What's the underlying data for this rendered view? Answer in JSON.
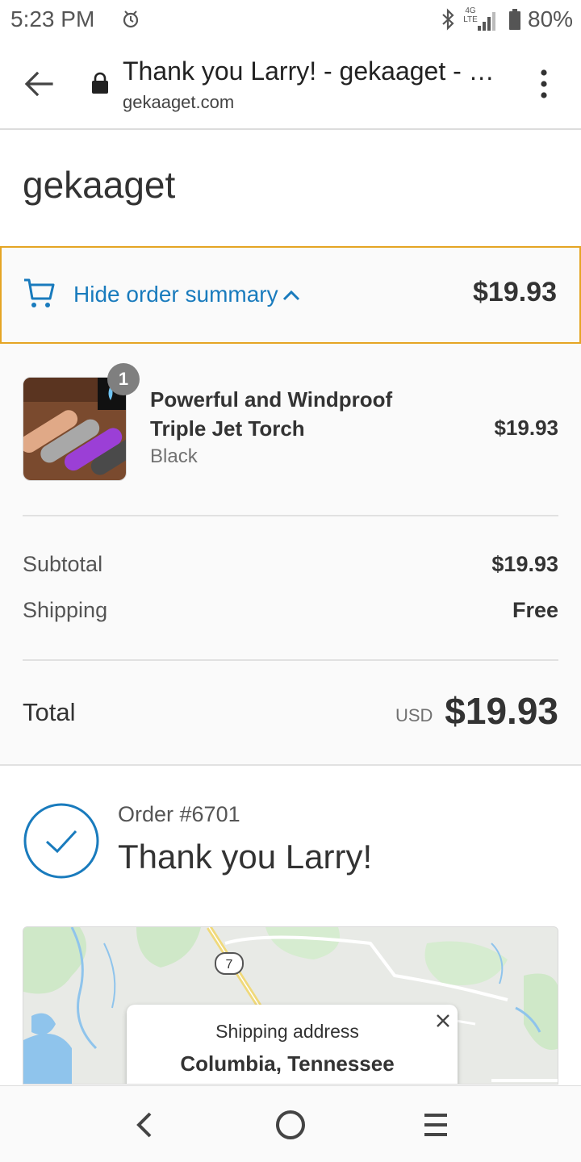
{
  "status_bar": {
    "time": "5:23 PM",
    "network_line1": "4G",
    "network_line2": "LTE",
    "battery": "80%"
  },
  "browser": {
    "title": "Thank you Larry! - gekaaget - C...",
    "url": "gekaaget.com"
  },
  "store": {
    "name": "gekaaget"
  },
  "summary_toggle": {
    "label": "Hide order summary",
    "price": "$19.93"
  },
  "order_summary": {
    "item": {
      "quantity": "1",
      "name": "Powerful and Windproof Triple Jet Torch",
      "variant": "Black",
      "price": "$19.93"
    },
    "subtotal_label": "Subtotal",
    "subtotal_value": "$19.93",
    "shipping_label": "Shipping",
    "shipping_value": "Free",
    "total_label": "Total",
    "currency": "USD",
    "total_value": "$19.93"
  },
  "confirmation": {
    "order_number": "Order #6701",
    "thank_you": "Thank you Larry!"
  },
  "map": {
    "route_label": "7",
    "address_title": "Shipping address",
    "address_city": "Columbia, Tennessee"
  },
  "colors": {
    "accent": "#197bbd",
    "toggle_border": "#e5a524",
    "panel_bg": "#fafafa"
  }
}
